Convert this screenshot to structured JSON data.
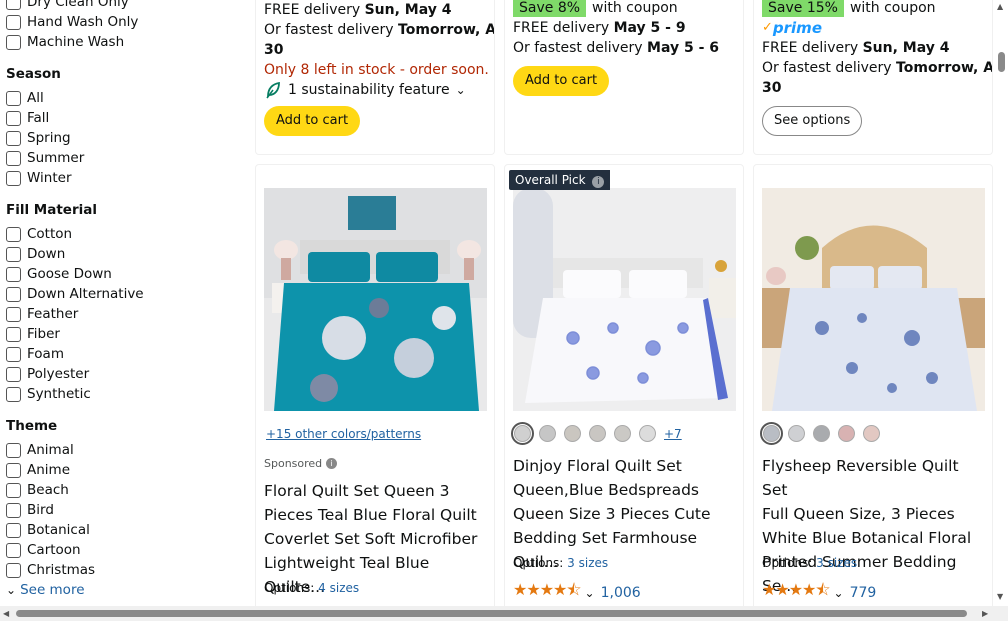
{
  "sidebar": {
    "care_items": [
      "Dry Clean Only",
      "Hand Wash Only",
      "Machine Wash"
    ],
    "season": {
      "heading": "Season",
      "items": [
        "All",
        "Fall",
        "Spring",
        "Summer",
        "Winter"
      ]
    },
    "fill": {
      "heading": "Fill Material",
      "items": [
        "Cotton",
        "Down",
        "Goose Down",
        "Down Alternative",
        "Feather",
        "Fiber",
        "Foam",
        "Polyester",
        "Synthetic"
      ]
    },
    "theme": {
      "heading": "Theme",
      "items": [
        "Animal",
        "Anime",
        "Beach",
        "Bird",
        "Botanical",
        "Cartoon",
        "Christmas"
      ]
    },
    "see_more": "See more"
  },
  "top_cards": [
    {
      "delivery_prefix": "FREE delivery ",
      "delivery_date": "Sun, May 4",
      "fast_prefix": "Or fastest delivery ",
      "fast_date_1": "Tomorrow, Apr",
      "fast_date_2": "30",
      "stock": "Only 8 left in stock - order soon.",
      "sustainability": "1 sustainability feature",
      "button": "Add to cart"
    },
    {
      "coupon": "Save 8%",
      "coupon_suffix": "with coupon",
      "delivery_prefix": "FREE delivery ",
      "delivery_date": "May 5 - 9",
      "fast_prefix": "Or fastest delivery ",
      "fast_date": "May 5 - 6",
      "button": "Add to cart"
    },
    {
      "coupon": "Save 15%",
      "coupon_suffix": "with coupon",
      "prime": "prime",
      "delivery_prefix": "FREE delivery ",
      "delivery_date": "Sun, May 4",
      "fast_prefix": "Or fastest delivery ",
      "fast_date_1": "Tomorrow, Apr",
      "fast_date_2": "30",
      "button": "See options"
    }
  ],
  "products": [
    {
      "colors_link": "+15 other colors/patterns",
      "sponsored": "Sponsored",
      "title": [
        "Floral Quilt Set Queen 3",
        "Pieces Teal Blue Floral Quilt",
        "Coverlet Set Soft Microfiber",
        "Lightweight Teal Blue Quilte..."
      ],
      "options_label": "Options: ",
      "options_value": "4 sizes"
    },
    {
      "badge": "Overall Pick",
      "more_swatches": "+7",
      "title": [
        "Dinjoy Floral Quilt Set",
        "Queen,Blue Bedspreads",
        "Queen Size 3 Pieces Cute",
        "Bedding Set Farmhouse Quil..."
      ],
      "options_label": "Options: ",
      "options_value": "3 sizes",
      "rating_count": "1,006"
    },
    {
      "title": [
        "Flysheep Reversible Quilt Set",
        "Full Queen Size, 3 Pieces",
        "White Blue Botanical Floral",
        "Printed Summer Bedding Se..."
      ],
      "options_label": "Options: ",
      "options_value": "3 sizes",
      "rating_count": "779"
    }
  ],
  "colors": {
    "accent_yellow": "#FFD814",
    "link_blue": "#2162A1",
    "stock_red": "#B12704",
    "coupon_green": "#7FDA69",
    "star_orange": "#E47911",
    "prime_blue": "#1A98FF"
  }
}
